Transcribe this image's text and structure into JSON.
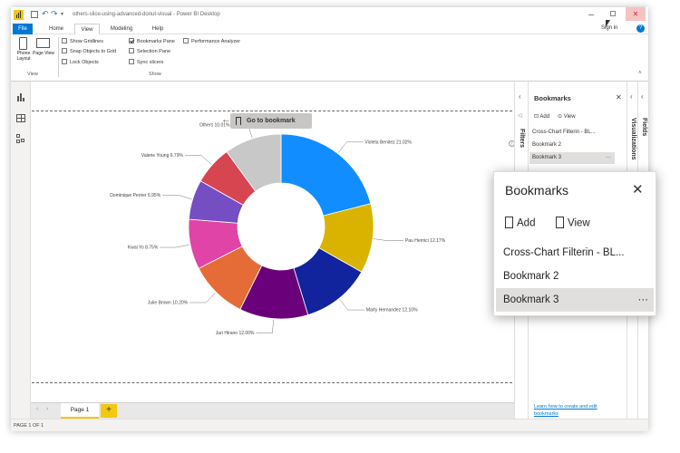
{
  "titlebar": {
    "doc_title": "others-slice-using-advanced-donut-visual - Power BI Desktop",
    "sign_in": "Sign in"
  },
  "ribbon_tabs": [
    "File",
    "Home",
    "View",
    "Modeling",
    "Help"
  ],
  "ribbon": {
    "phone_layout": "Phone Layout",
    "page_view": "Page View",
    "view_group": "View",
    "show_group": "Show",
    "checkboxes": [
      {
        "label": "Show Gridlines",
        "checked": false
      },
      {
        "label": "Snap Objects to Grid",
        "checked": false
      },
      {
        "label": "Lock Objects",
        "checked": false
      },
      {
        "label": "Bookmarks Pane",
        "checked": true
      },
      {
        "label": "Selection Pane",
        "checked": false
      },
      {
        "label": "Sync slicers",
        "checked": false
      },
      {
        "label": "Performance Analyzer",
        "checked": false
      }
    ]
  },
  "canvas": {
    "go_to_bookmark": "Go to bookmark"
  },
  "chart_data": {
    "type": "pie",
    "categories": [
      "Violeta Benitez",
      "Pau Hernici",
      "Marty Hernandez",
      "Juri Hirano",
      "Julie Brown",
      "Kwai Yo",
      "Dominique Perrier",
      "Valerie Young",
      "Others"
    ],
    "values": [
      21.02,
      12.17,
      12.1,
      12.0,
      10.2,
      8.75,
      6.95,
      6.79,
      10.01
    ],
    "labels": [
      "Violeta Benitez 21.02%",
      "Pau Hernici 12.17%",
      "Marty Hernandez 12.10%",
      "Juri Hirano 12.00%",
      "Julie Brown 10.20%",
      "Kwai Yo 8.75%",
      "Dominique Perrier 6.95%",
      "Valerie Young 6.79%",
      "Others 10.01%"
    ],
    "colors": [
      "#118dff",
      "#d9b300",
      "#12239e",
      "#6b007b",
      "#e66c37",
      "#e044a7",
      "#744ec2",
      "#d64550",
      "#c8c8c8"
    ],
    "hole": "donut"
  },
  "page_tabs": {
    "page1": "Page 1",
    "add": "+"
  },
  "statusbar": {
    "text": "PAGE 1 OF 1"
  },
  "panes": {
    "filters": "Filters",
    "visualizations": "Visualizations",
    "fields": "Fields"
  },
  "bookmarks_pane": {
    "title": "Bookmarks",
    "add": "Add",
    "view": "View",
    "items": [
      "Cross-Chart Filterin - BL...",
      "Bookmark 2",
      "Bookmark 3"
    ],
    "more": "···",
    "footer_link": "Learn how to create and edit bookmarks"
  },
  "popup": {
    "title": "Bookmarks",
    "add": "Add",
    "view": "View",
    "items": [
      "Cross-Chart Filterin - BL...",
      "Bookmark 2",
      "Bookmark 3"
    ],
    "more": "···"
  },
  "colors": {
    "accent": "#0078d4",
    "add_page": "#f2c811",
    "selected_row": "#e1dfdd"
  }
}
